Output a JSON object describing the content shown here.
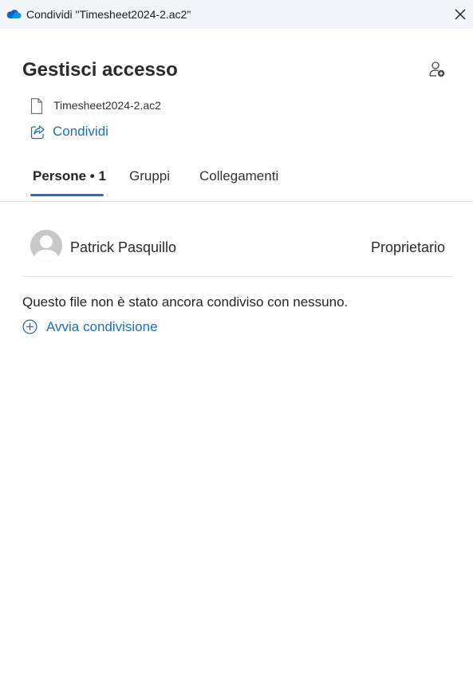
{
  "window": {
    "title": "Condividi \"Timesheet2024-2.ac2\"",
    "app_icon": "onedrive-cloud-icon",
    "close_icon": "close-icon"
  },
  "header": {
    "title": "Gestisci accesso",
    "add_person_icon": "person-add-icon"
  },
  "file": {
    "name": "Timesheet2024-2.ac2",
    "icon": "document-icon"
  },
  "share": {
    "label": "Condividi",
    "icon": "share-icon"
  },
  "tabs": [
    {
      "label": "Persone • 1",
      "active": true
    },
    {
      "label": "Gruppi",
      "active": false
    },
    {
      "label": "Collegamenti",
      "active": false
    }
  ],
  "people": [
    {
      "name": "Patrick Pasquillo",
      "role": "Proprietario"
    }
  ],
  "empty_state": {
    "message": "Questo file non è stato ancora condiviso con nessuno.",
    "action_label": "Avvia condivisione",
    "action_icon": "add-circle-icon"
  },
  "colors": {
    "accent": "#1f6fba",
    "titlebar_bg": "#f1f4f8",
    "onedrive_blue": "#0a64c8"
  }
}
